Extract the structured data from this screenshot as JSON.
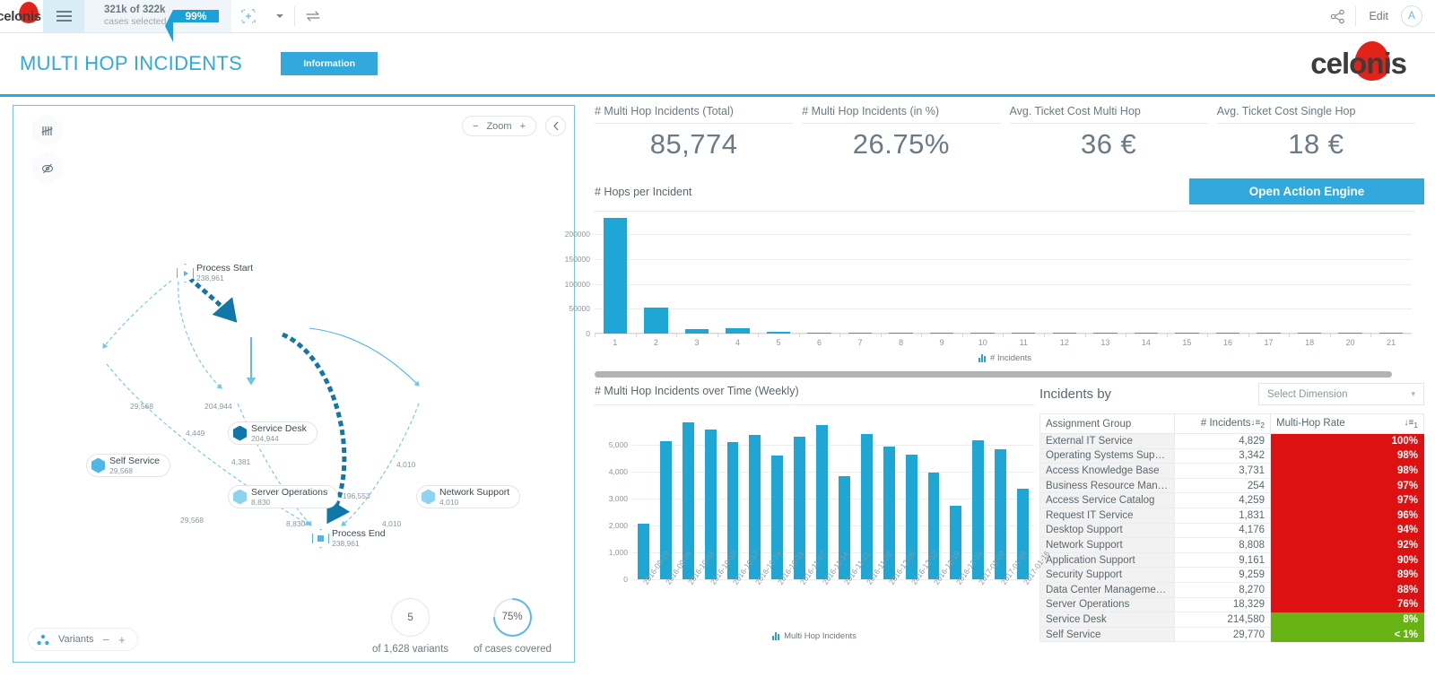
{
  "topbar": {
    "logo_text": "celonis",
    "menu_icon": "hamburger-icon",
    "cases_line1": "321k of 322k",
    "cases_line2": "cases selected",
    "selection_pct": "99%",
    "selection_icon": "selection-box-icon",
    "dropdown_icon": "caret-down-icon",
    "swap_icon": "swap-arrows-icon",
    "share_icon": "share-icon",
    "edit_label": "Edit",
    "avatar_initial": "A"
  },
  "title_bar": {
    "title": "MULTI HOP INCIDENTS",
    "information_button": "Information",
    "brand": "celonis"
  },
  "process_panel": {
    "tally_icon": "tally-marks-icon",
    "eye_off_icon": "eye-off-icon",
    "zoom_label": "Zoom",
    "zoom_minus": "−",
    "zoom_plus": "+",
    "collapse_icon": "chevron-left-icon",
    "variants_label": "Variants",
    "variants_icon": "variants-icon",
    "variants_minus": "−",
    "variants_plus": "+",
    "variants_count": "5",
    "variants_caption": "of 1,628 variants",
    "coverage_pct": "75%",
    "coverage_caption": "of cases covered",
    "nodes": [
      {
        "label": "Process Start",
        "value": "238,961"
      },
      {
        "label": "Service Desk",
        "value": "204,944"
      },
      {
        "label": "Self Service",
        "value": "29,568"
      },
      {
        "label": "Server Operations",
        "value": "8,830"
      },
      {
        "label": "Network Support",
        "value": "4,010"
      },
      {
        "label": "Process End",
        "value": "238,961"
      }
    ],
    "edges": [
      {
        "value": "29,568"
      },
      {
        "value": "204,944"
      },
      {
        "value": "4,449"
      },
      {
        "value": "4,381"
      },
      {
        "value": "4,010"
      },
      {
        "value": "29,568"
      },
      {
        "value": "196,553"
      },
      {
        "value": "8,830"
      },
      {
        "value": "4,010"
      }
    ]
  },
  "kpis": [
    {
      "label": "# Multi Hop Incidents (Total)",
      "value": "85,774"
    },
    {
      "label": "# Multi Hop Incidents (in %)",
      "value": "26.75%"
    },
    {
      "label": "Avg. Ticket Cost Multi Hop",
      "value": "36 €"
    },
    {
      "label": "Avg. Ticket Cost Single Hop",
      "value": "18 €"
    }
  ],
  "hops_section": {
    "title": "# Hops per Incident",
    "action_button": "Open Action Engine",
    "legend": "# Incidents"
  },
  "weekly_section": {
    "title": "# Multi Hop Incidents over Time (Weekly)",
    "legend": "Multi Hop Incidents"
  },
  "incidents_table": {
    "title": "Incidents by",
    "dimension_placeholder": "Select Dimension",
    "columns": [
      "Assignment Group",
      "# Incidents",
      "Multi-Hop Rate"
    ],
    "sort_badge_incidents": "2",
    "sort_badge_rate": "1",
    "rows": [
      {
        "group": "External IT Service",
        "incidents": "4,829",
        "rate": "100%",
        "color": "#dd1111"
      },
      {
        "group": "Operating Systems Support",
        "incidents": "3,342",
        "rate": "98%",
        "color": "#dd1111"
      },
      {
        "group": "Access Knowledge Base",
        "incidents": "3,731",
        "rate": "98%",
        "color": "#dd1111"
      },
      {
        "group": "Business Resource Mana...",
        "incidents": "254",
        "rate": "97%",
        "color": "#dd1111"
      },
      {
        "group": "Access Service Catalog",
        "incidents": "4,259",
        "rate": "97%",
        "color": "#dd1111"
      },
      {
        "group": "Request IT Service",
        "incidents": "1,831",
        "rate": "96%",
        "color": "#dd1111"
      },
      {
        "group": "Desktop Support",
        "incidents": "4,176",
        "rate": "94%",
        "color": "#dd1111"
      },
      {
        "group": "Network Support",
        "incidents": "8,808",
        "rate": "92%",
        "color": "#dd1111"
      },
      {
        "group": "Application Support",
        "incidents": "9,161",
        "rate": "90%",
        "color": "#dd1111"
      },
      {
        "group": "Security Support",
        "incidents": "9,259",
        "rate": "89%",
        "color": "#dd1111"
      },
      {
        "group": "Data Center Management...",
        "incidents": "8,270",
        "rate": "88%",
        "color": "#dd1111"
      },
      {
        "group": "Server Operations",
        "incidents": "18,329",
        "rate": "76%",
        "color": "#dd1111"
      },
      {
        "group": "Service Desk",
        "incidents": "214,580",
        "rate": "8%",
        "color": "#66b313"
      },
      {
        "group": "Self Service",
        "incidents": "29,770",
        "rate": "< 1%",
        "color": "#66b313"
      }
    ]
  },
  "chart_data": [
    {
      "type": "bar",
      "title": "# Hops per Incident",
      "xlabel": "",
      "ylabel": "",
      "legend": "# Incidents",
      "legend_position": "bottom",
      "grid": true,
      "ylim": [
        0,
        235000
      ],
      "yticks": [
        0,
        50000,
        100000,
        150000,
        200000
      ],
      "ytick_labels": [
        "0",
        "50000",
        "100000",
        "150000",
        "200000"
      ],
      "categories": [
        "1",
        "2",
        "3",
        "4",
        "5",
        "6",
        "7",
        "8",
        "9",
        "10",
        "11",
        "12",
        "13",
        "14",
        "15",
        "16",
        "17",
        "18",
        "20",
        "21"
      ],
      "values": [
        233000,
        52500,
        9800,
        11500,
        4200,
        2000,
        800,
        300,
        150,
        90,
        60,
        40,
        30,
        20,
        15,
        10,
        8,
        6,
        4,
        3
      ],
      "color": "#1ea7d5"
    },
    {
      "type": "bar",
      "title": "# Multi Hop Incidents over Time (Weekly)",
      "xlabel": "",
      "ylabel": "",
      "legend": "Multi Hop Incidents",
      "legend_position": "bottom",
      "grid": true,
      "ylim": [
        0,
        6000
      ],
      "yticks": [
        0,
        1000,
        2000,
        3000,
        4000,
        5000
      ],
      "ytick_labels": [
        "0",
        "1,000",
        "2,000",
        "3,000",
        "4,000",
        "5,000"
      ],
      "categories": [
        "2016-09-19",
        "2016-09-26",
        "2016-10-03",
        "2016-10-10",
        "2016-10-17",
        "2016-10-24",
        "2016-10-31",
        "2016-11-07",
        "2016-11-14",
        "2016-11-21",
        "2016-11-28",
        "2016-12-05",
        "2016-12-12",
        "2016-12-19",
        "2016-12-26",
        "2017-01-02",
        "2017-01-09",
        "2017-01-16"
      ],
      "values": [
        2080,
        5140,
        5820,
        5560,
        5100,
        5370,
        4590,
        5300,
        5750,
        3830,
        5400,
        4950,
        4650,
        3970,
        2720,
        5180,
        4850,
        3380
      ],
      "color": "#1ea7d5"
    }
  ]
}
